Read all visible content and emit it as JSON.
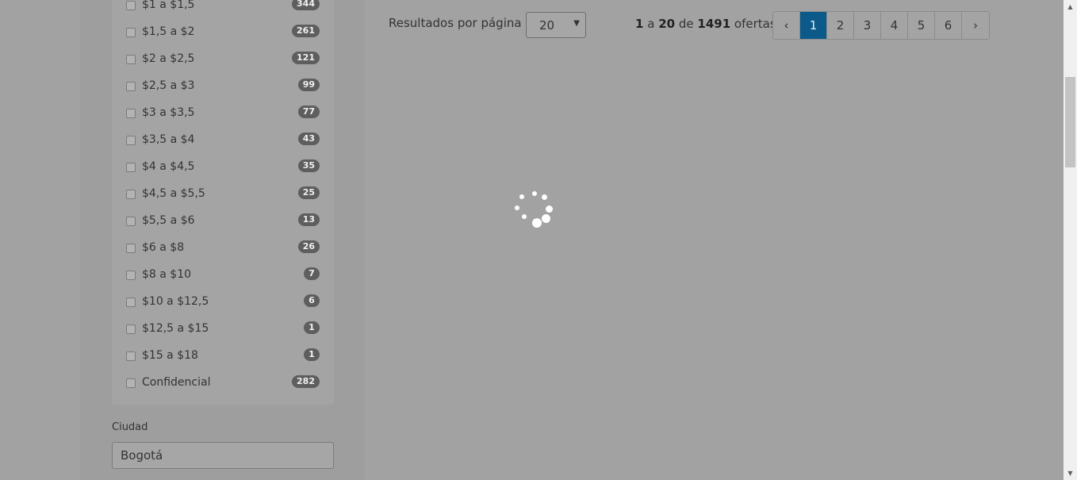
{
  "salary_filter": {
    "items": [
      {
        "label": "$1 a $1,5",
        "count": "344"
      },
      {
        "label": "$1,5 a $2",
        "count": "261"
      },
      {
        "label": "$2 a $2,5",
        "count": "121"
      },
      {
        "label": "$2,5 a $3",
        "count": "99"
      },
      {
        "label": "$3 a $3,5",
        "count": "77"
      },
      {
        "label": "$3,5 a $4",
        "count": "43"
      },
      {
        "label": "$4 a $4,5",
        "count": "35"
      },
      {
        "label": "$4,5 a $5,5",
        "count": "25"
      },
      {
        "label": "$5,5 a $6",
        "count": "13"
      },
      {
        "label": "$6 a $8",
        "count": "26"
      },
      {
        "label": "$8 a $10",
        "count": "7"
      },
      {
        "label": "$10 a $12,5",
        "count": "6"
      },
      {
        "label": "$12,5 a $15",
        "count": "1"
      },
      {
        "label": "$15 a $18",
        "count": "1"
      },
      {
        "label": "Confidencial",
        "count": "282"
      }
    ]
  },
  "city_filter": {
    "label": "Ciudad",
    "value": "Bogotá"
  },
  "results_toolbar": {
    "per_page_label": "Resultados por página",
    "per_page_value": "20",
    "summary": {
      "from": "1",
      "sep1": "a",
      "to": "20",
      "sep2": "de",
      "total": "1491",
      "suffix": "ofertas"
    },
    "pagination": {
      "prev": "‹",
      "pages": [
        "1",
        "2",
        "3",
        "4",
        "5",
        "6"
      ],
      "active_page": "1",
      "next": "›"
    }
  },
  "loading": {
    "icon": "loading-spinner-icon"
  },
  "scrollbar": {
    "up": "▲",
    "down": "▼"
  }
}
